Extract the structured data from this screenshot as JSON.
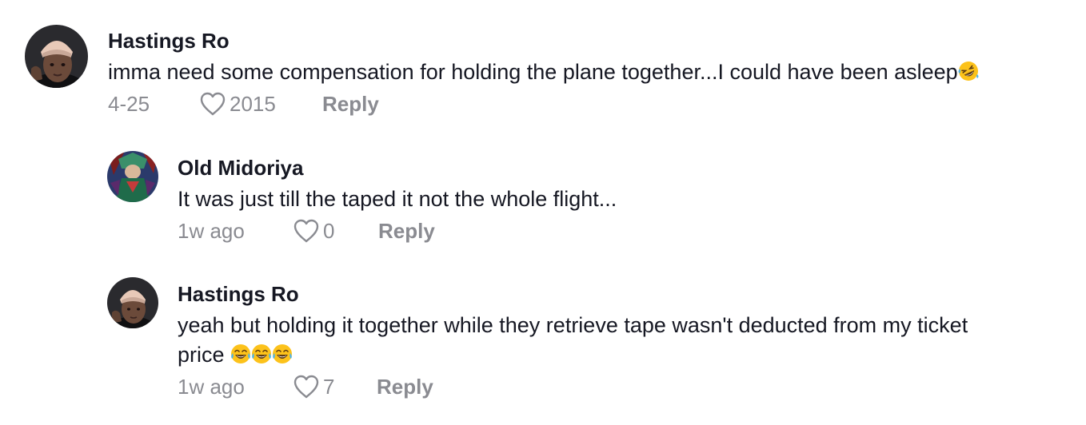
{
  "comments": [
    {
      "author": "Hastings Ro",
      "text": "imma need some compensation for holding the plane together...I could have been asleep",
      "emoji": "rolling-on-floor-laughing-emoji",
      "date": "4-25",
      "likes": "2015",
      "reply_label": "Reply"
    },
    {
      "author": "Old Midoriya",
      "text": "It was just till the taped it not the whole flight...",
      "date": "1w ago",
      "likes": "0",
      "reply_label": "Reply"
    },
    {
      "author": "Hastings Ro",
      "text_line1": "yeah but holding it together while they retrieve tape wasn't deducted from my ticket",
      "text_line2": "price",
      "emoji": "face-with-tears-of-joy-emoji x3",
      "date": "1w ago",
      "likes": "7",
      "reply_label": "Reply"
    }
  ],
  "colors": {
    "primary_text": "#161823",
    "secondary_text": "#8a8b91",
    "background": "#ffffff"
  }
}
